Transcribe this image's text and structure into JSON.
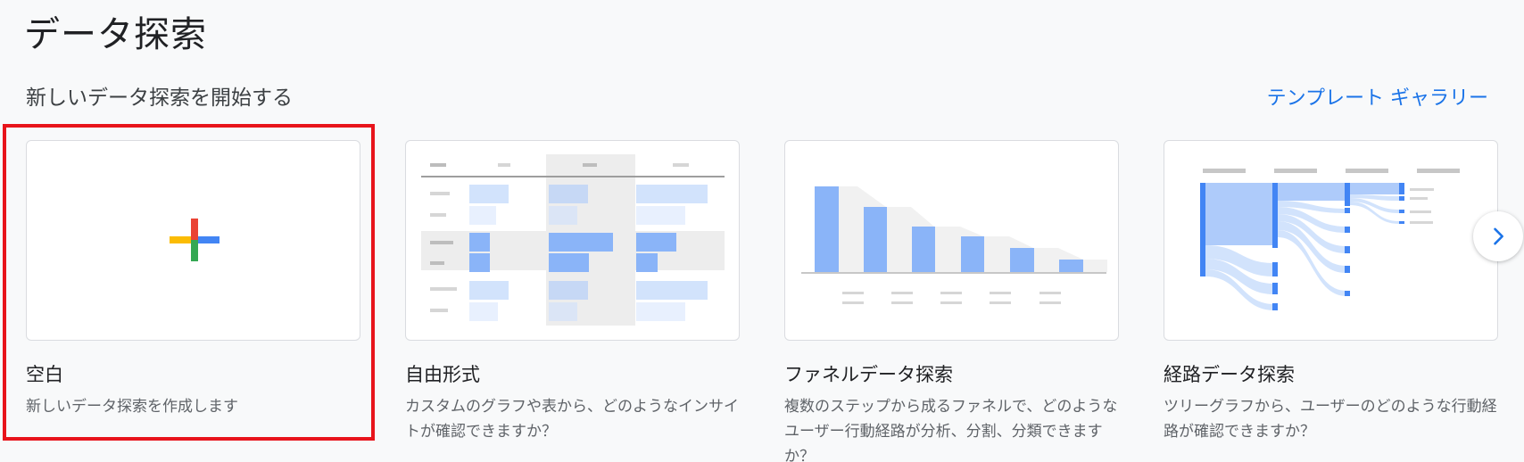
{
  "header": {
    "title": "データ探索"
  },
  "section": {
    "title": "新しいデータ探索を開始する",
    "gallery_link": "テンプレート ギャラリー"
  },
  "cards": [
    {
      "title": "空白",
      "description": "新しいデータ探索を作成します"
    },
    {
      "title": "自由形式",
      "description": "カスタムのグラフや表から、どのようなインサイトが確認できますか？"
    },
    {
      "title": "ファネルデータ探索",
      "description": "複数のステップから成るファネルで、どのようなユーザー行動経路が分析、分割、分類できますか？"
    },
    {
      "title": "経路データ探索",
      "description": "ツリーグラフから、ユーザーのどのような行動経路が確認できますか？"
    }
  ],
  "colors": {
    "accent": "#1a73e8",
    "highlight": "#e8141b",
    "plus_red": "#ea4335",
    "plus_blue": "#4285f4",
    "plus_green": "#34a853",
    "plus_yellow": "#fbbc04"
  },
  "icons": {
    "blank": "plus-icon",
    "next": "chevron-right-icon"
  }
}
